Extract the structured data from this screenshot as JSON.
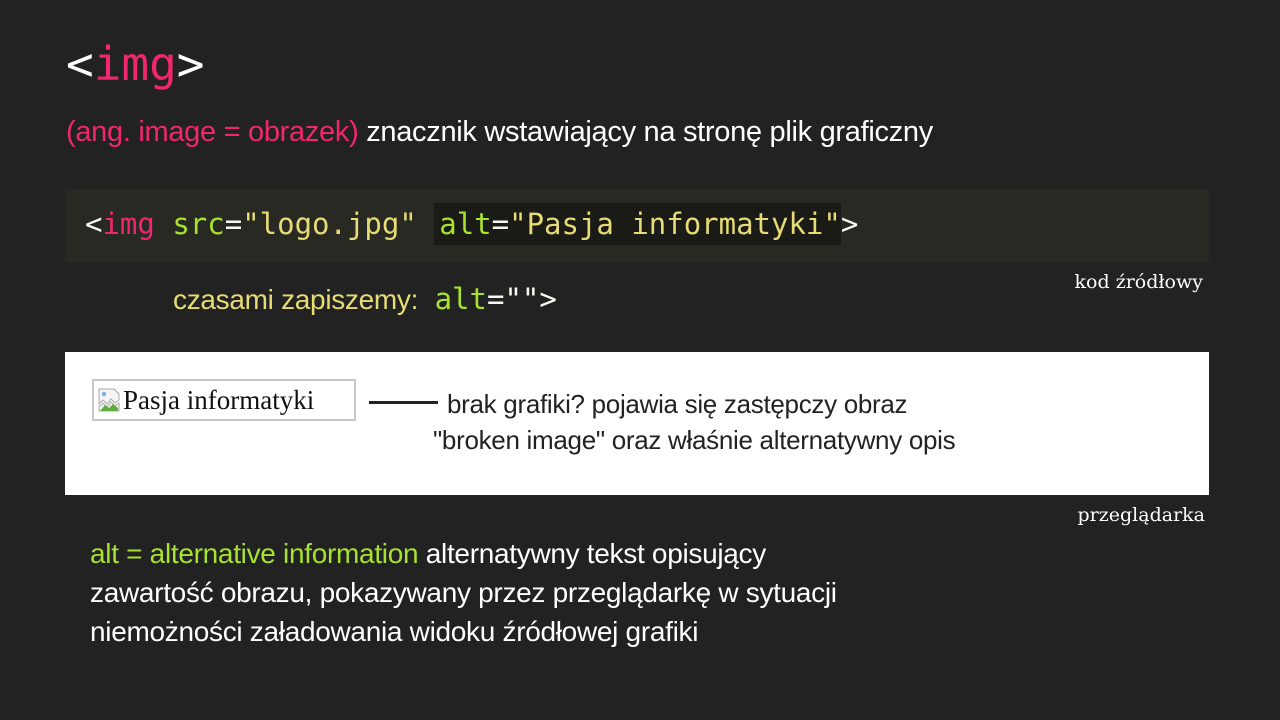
{
  "title": {
    "open": "<",
    "tag": "img",
    "close": ">"
  },
  "subtitle": {
    "translation": "(ang. image = obrazek)",
    "description": "znacznik wstawiający na stronę plik graficzny"
  },
  "code": {
    "open_bracket": "<",
    "tag": "img",
    "src_attr": "src",
    "eq1": "=",
    "src_value": "\"logo.jpg\"",
    "alt_attr": "alt",
    "eq2": "=",
    "alt_value": "\"Pasja informatyki\"",
    "close_bracket": ">"
  },
  "label_source": "kod źródłowy",
  "sometimes": {
    "text": "czasami zapiszemy:",
    "alt_attr": "alt",
    "eq": "=",
    "value": "\"\"",
    "close": ">"
  },
  "browser_demo": {
    "alt_text": "Pasja informatyki",
    "note_line1": "brak grafiki? pojawia się zastępczy obraz",
    "note_line2": "\"broken image\" oraz właśnie alternatywny opis"
  },
  "label_browser": "przeglądarka",
  "description": {
    "highlight": "alt = alternative information",
    "line1_rest": " alternatywny tekst opisujący",
    "line2": "zawartość obrazu, pokazywany przez przeglądarkę w sytuacji",
    "line3": "niemożności załadowania widoku źródłowej grafiki"
  },
  "colors": {
    "background": "#222222",
    "accent_pink": "#f0266f",
    "accent_green": "#a6e22e",
    "accent_yellow": "#e6db74",
    "code_background": "#282923"
  }
}
